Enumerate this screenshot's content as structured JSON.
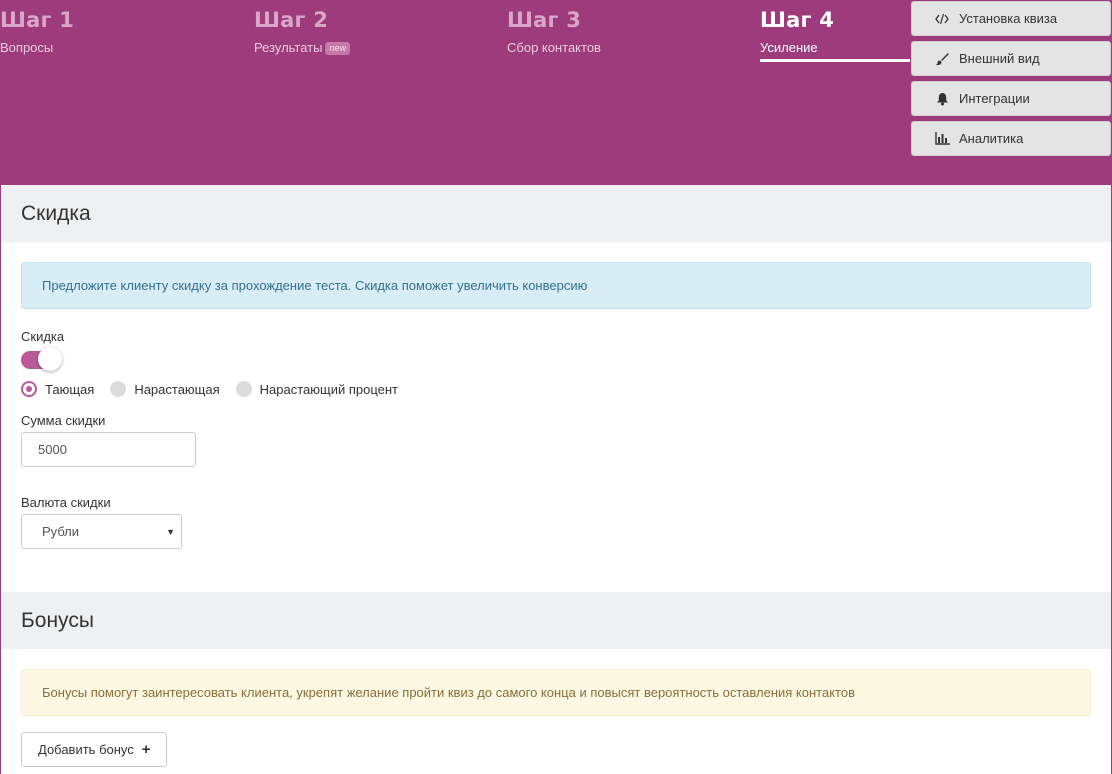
{
  "steps": [
    {
      "title": "Шаг 1",
      "sub": "Вопросы"
    },
    {
      "title": "Шаг 2",
      "sub": "Результаты",
      "badge": "new"
    },
    {
      "title": "Шаг 3",
      "sub": "Сбор контактов"
    },
    {
      "title": "Шаг 4",
      "sub": "Усиление"
    }
  ],
  "active_step": 4,
  "side_menu": [
    {
      "label": "Установка квиза",
      "icon": "code-icon"
    },
    {
      "label": "Внешний вид",
      "icon": "brush-icon"
    },
    {
      "label": "Интеграции",
      "icon": "bell-icon"
    },
    {
      "label": "Аналитика",
      "icon": "bar-chart-icon"
    }
  ],
  "discount": {
    "heading": "Скидка",
    "info": "Предложите клиенту скидку за прохождение теста. Скидка поможет увеличить конверсию",
    "toggle_label": "Скидка",
    "toggle_on": true,
    "radios": [
      "Тающая",
      "Нарастающая",
      "Нарастающий процент"
    ],
    "selected_radio": "Тающая",
    "amount_label": "Сумма скидки",
    "amount_value": "5000",
    "currency_label": "Валюта скидки",
    "currency_value": "Рубли"
  },
  "bonuses": {
    "heading": "Бонусы",
    "info": "Бонусы помогут заинтересовать клиента, укрепят желание пройти квиз до самого конца и повысят вероятность оставления контактов",
    "add_button": "Добавить бонус"
  },
  "colors": {
    "brand": "#9d3b7d",
    "accent": "#b85a97"
  }
}
